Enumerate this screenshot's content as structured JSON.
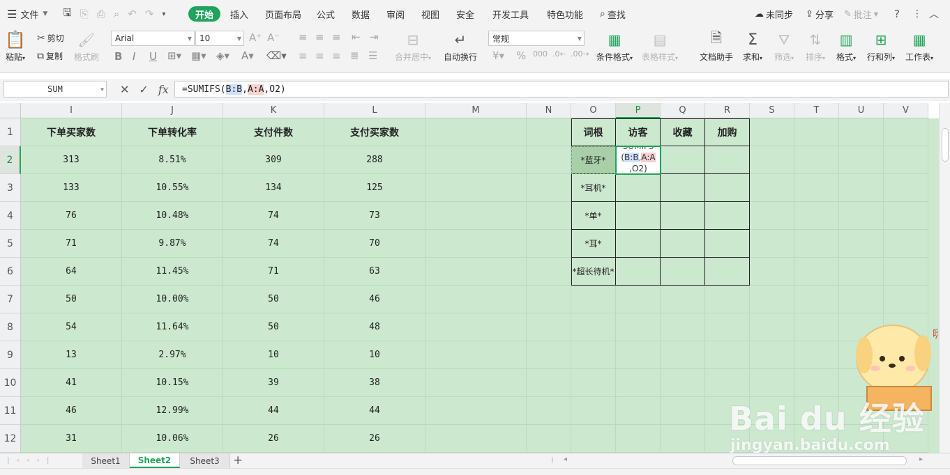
{
  "menubar": {
    "hamburger_icon": "menu-icon",
    "file_label": "文件",
    "tabs": [
      "开始",
      "插入",
      "页面布局",
      "公式",
      "数据",
      "审阅",
      "视图",
      "安全",
      "开发工具",
      "特色功能"
    ],
    "active_tab": "开始",
    "search_label": "查找",
    "sync_label": "未同步",
    "share_label": "分享",
    "comment_label": "批注"
  },
  "ribbon": {
    "paste_label": "粘贴",
    "cut_label": "剪切",
    "copy_label": "复制",
    "format_painter_label": "格式刷",
    "font_name": "Arial",
    "font_size": "10",
    "number_format": "常规",
    "merge_center_label": "合并居中",
    "wrap_text_label": "自动换行",
    "conditional_format_label": "条件格式",
    "table_style_label": "表格样式",
    "doc_assistant_label": "文档助手",
    "sum_label": "求和",
    "filter_label": "筛选",
    "sort_label": "排序",
    "format_label": "格式",
    "rows_cols_label": "行和列",
    "worksheet_label": "工作表"
  },
  "formula_bar": {
    "name_box": "SUM",
    "fx_label": "fx",
    "formula_prefix": "=SUMIFS(",
    "ref1": "B:B",
    "sep1": ",",
    "ref2": "A:A",
    "suffix": ",O2)"
  },
  "columns": [
    "I",
    "J",
    "K",
    "L",
    "M",
    "N",
    "O",
    "P",
    "Q",
    "R",
    "S",
    "T",
    "U",
    "V"
  ],
  "selected_column": "P",
  "rows": [
    "1",
    "2",
    "3",
    "4",
    "5",
    "6",
    "7",
    "8",
    "9",
    "10",
    "11",
    "12"
  ],
  "selected_row": "2",
  "left_table": {
    "headers": [
      "下单买家数",
      "下单转化率",
      "支付件数",
      "支付买家数"
    ],
    "data": [
      [
        "313",
        "8.51%",
        "309",
        "288"
      ],
      [
        "133",
        "10.55%",
        "134",
        "125"
      ],
      [
        "76",
        "10.48%",
        "74",
        "73"
      ],
      [
        "71",
        "9.87%",
        "74",
        "70"
      ],
      [
        "64",
        "11.45%",
        "71",
        "63"
      ],
      [
        "50",
        "10.00%",
        "50",
        "46"
      ],
      [
        "54",
        "11.64%",
        "50",
        "48"
      ],
      [
        "13",
        "2.97%",
        "10",
        "10"
      ],
      [
        "41",
        "10.15%",
        "39",
        "38"
      ],
      [
        "46",
        "12.99%",
        "44",
        "44"
      ],
      [
        "31",
        "10.06%",
        "26",
        "26"
      ]
    ]
  },
  "right_table": {
    "headers": [
      "词根",
      "访客",
      "收藏",
      "加购"
    ],
    "keywords": [
      "*蓝牙*",
      "*耳机*",
      "*单*",
      "*耳*",
      "*超长待机*"
    ]
  },
  "editing_cell": {
    "line1": "SUMIFS",
    "line2_a": "(",
    "line2_ref1": "B:B",
    "line2_sep": ",",
    "line2_ref2": "A:A",
    "line3": ",O2)"
  },
  "sheets": [
    "Sheet1",
    "Sheet2",
    "Sheet3"
  ],
  "active_sheet": "Sheet2",
  "add_sheet_label": "+",
  "watermark": {
    "line1": "Bai du 经验",
    "line2": "jingyan.baidu.com"
  },
  "mascot_speech": "嗨"
}
